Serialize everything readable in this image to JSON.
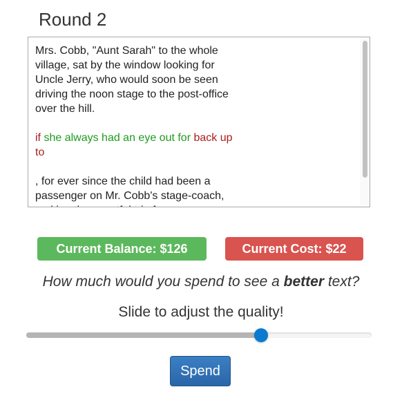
{
  "round": {
    "title": "Round 2"
  },
  "passage": {
    "paragraph1": "Mrs. Cobb, \"Aunt Sarah\" to the whole village, sat by the window looking for Uncle Jerry, who would soon be seen driving the noon stage to the post-office over the hill.",
    "highlight_red_1": "if",
    "highlight_green": " she always had an eye out for",
    "highlight_red_2": " back up to",
    "paragraph3": ", for ever since the child had been a passenger on Mr. Cobb's stage-coach, making the eventful trip from"
  },
  "status": {
    "balance": "Current Balance: $126",
    "cost": "Current Cost: $22",
    "balance_color": "#5cb85c",
    "cost_color": "#d9534f"
  },
  "prompt": {
    "question_prefix": "How much would you spend to see a ",
    "question_emphasis": "better",
    "question_suffix": " text?",
    "slider_label": "Slide to adjust the quality!"
  },
  "slider": {
    "value_fraction": 0.68,
    "accent_color": "#0a7bd0"
  },
  "actions": {
    "spend_label": "Spend"
  }
}
